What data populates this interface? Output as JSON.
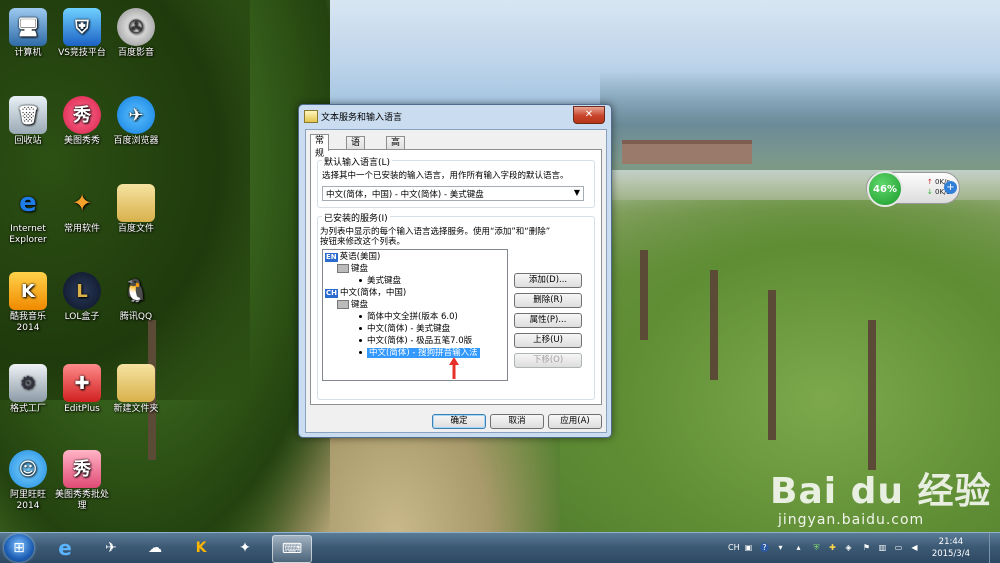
{
  "desktop": {
    "icons": [
      {
        "label": "计算机",
        "icon": "computer-icon"
      },
      {
        "label": "VS竞技平台",
        "icon": "shield-icon"
      },
      {
        "label": "百度影音",
        "icon": "film-reel-icon"
      },
      {
        "label": "回收站",
        "icon": "recycle-bin-icon"
      },
      {
        "label": "美图秀秀",
        "icon": "meitu-icon"
      },
      {
        "label": "百度浏览器",
        "icon": "baidu-browser-icon"
      },
      {
        "label": "Internet Explorer",
        "icon": "ie-icon"
      },
      {
        "label": "常用软件",
        "icon": "app-folder-icon"
      },
      {
        "label": "百度文件",
        "icon": "folder-icon"
      },
      {
        "label": "酷我音乐 2014",
        "icon": "kuwo-icon"
      },
      {
        "label": "LOL盒子",
        "icon": "lol-box-icon"
      },
      {
        "label": "腾讯QQ",
        "icon": "qq-penguin-icon"
      },
      {
        "label": "格式工厂",
        "icon": "format-factory-icon"
      },
      {
        "label": "EditPlus",
        "icon": "editplus-icon"
      },
      {
        "label": "新建文件夹",
        "icon": "folder-icon"
      },
      {
        "label": "阿里旺旺 2014",
        "icon": "aliwangwang-icon"
      },
      {
        "label": "美图秀秀批处理",
        "icon": "meitu-batch-icon"
      }
    ],
    "watermark": "Bai du 经验",
    "watermark_sub": "jingyan.baidu.com"
  },
  "net_widget": {
    "percent": "46%",
    "up_speed": "0K/s",
    "down_speed": "0K/s"
  },
  "dialog": {
    "title": "文本服务和输入语言",
    "close": "✕",
    "tabs": [
      "常规",
      "语言栏",
      "高级键设置"
    ],
    "default_group": {
      "label": "默认输入语言(L)",
      "description": "选择其中一个已安装的输入语言，用作所有输入字段的默认语言。",
      "selected": "中文(简体，中国) - 中文(简体) - 美式键盘"
    },
    "installed_group": {
      "label": "已安装的服务(I)",
      "description_line1": "为列表中显示的每个输入语言选择服务。使用“添加”和“删除”",
      "description_line2": "按钮来修改这个列表。",
      "tree": {
        "lang1": {
          "badge": "EN",
          "label": "英语(美国)"
        },
        "lang1_keyboard": "键盘",
        "lang1_items": [
          "美式键盘"
        ],
        "lang2": {
          "badge": "CH",
          "label": "中文(简体，中国)"
        },
        "lang2_keyboard": "键盘",
        "lang2_items": [
          "简体中文全拼(版本 6.0)",
          "中文(简体) - 美式键盘",
          "中文(简体) - 极品五笔7.0版",
          "中文(简体) - 搜狗拼音输入法"
        ]
      },
      "buttons": {
        "add": "添加(D)...",
        "remove": "删除(R)",
        "properties": "属性(P)...",
        "move_up": "上移(U)",
        "move_down": "下移(O)"
      }
    },
    "footer": {
      "ok": "确定",
      "cancel": "取消",
      "apply": "应用(A)"
    }
  },
  "taskbar": {
    "pinned": [
      {
        "icon": "ie-icon"
      },
      {
        "icon": "baidu-browser-icon"
      },
      {
        "icon": "cloud-icon"
      },
      {
        "icon": "kuwo-icon"
      },
      {
        "icon": "game-icon"
      },
      {
        "icon": "language-settings-icon"
      }
    ],
    "tray": {
      "language": "CH",
      "time": "21:44",
      "date": "2015/3/4"
    }
  }
}
